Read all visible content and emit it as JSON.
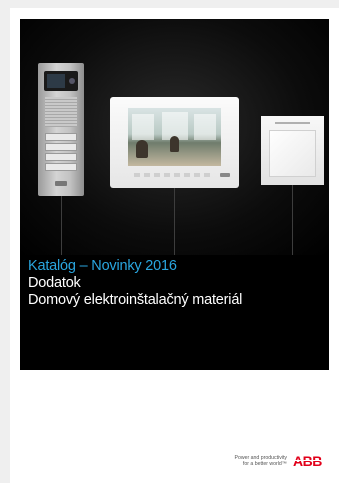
{
  "cover": {
    "title": "Katalóg – Novinky 2016",
    "subtitle": "Dodatok",
    "description": "Domový elektroinštalačný materiál",
    "title_color": "#2aa6df",
    "panel_color": "#000000"
  },
  "images": {
    "door_station": "door-station-product",
    "indoor_monitor": "indoor-video-monitor-product",
    "switch": "light-switch-product"
  },
  "footer": {
    "tagline_line1": "Power and productivity",
    "tagline_line2": "for a better world™",
    "logo_text": "ABB",
    "logo_color": "#e2001a"
  }
}
